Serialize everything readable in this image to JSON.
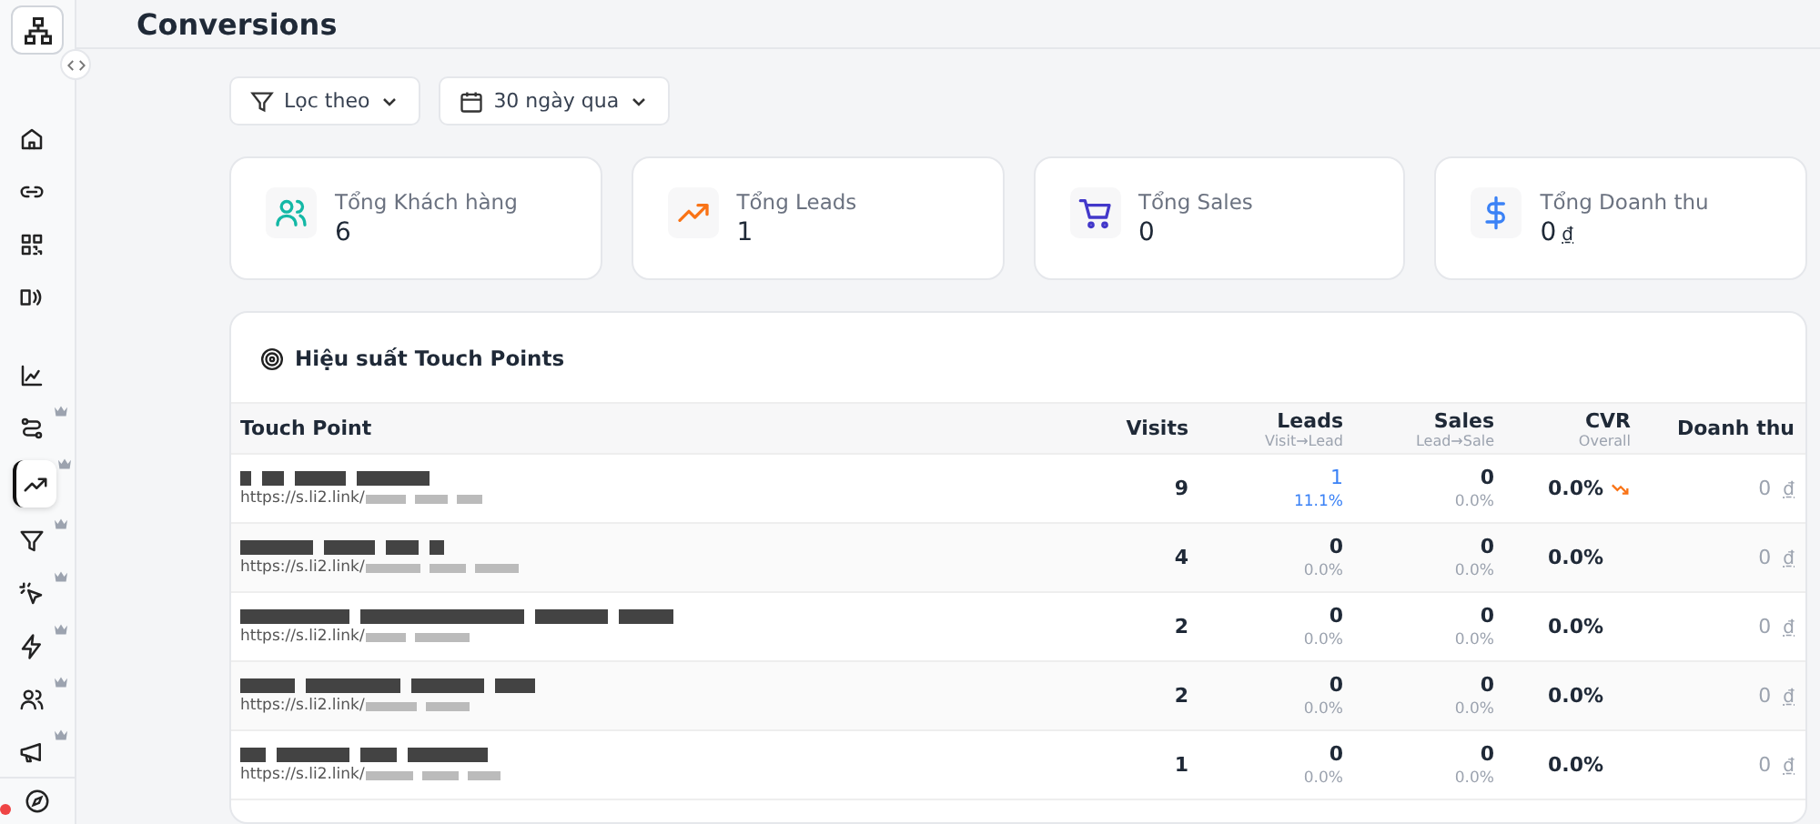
{
  "page_title": "Conversions",
  "sidebar": {
    "items": [
      {
        "kind": "home",
        "premium": false,
        "selected": false
      },
      {
        "kind": "link",
        "premium": false,
        "selected": false
      },
      {
        "kind": "qr",
        "premium": false,
        "selected": false
      },
      {
        "kind": "nfc",
        "premium": false,
        "selected": false
      },
      {
        "kind": "chart",
        "premium": false,
        "selected": false
      },
      {
        "kind": "route",
        "premium": true,
        "selected": false
      },
      {
        "kind": "trend",
        "premium": true,
        "selected": true
      },
      {
        "kind": "funnel",
        "premium": true,
        "selected": false
      },
      {
        "kind": "click",
        "premium": true,
        "selected": false
      },
      {
        "kind": "bolt",
        "premium": true,
        "selected": false
      },
      {
        "kind": "users",
        "premium": true,
        "selected": false
      },
      {
        "kind": "megaphone",
        "premium": true,
        "selected": false
      }
    ],
    "notification": true
  },
  "filters": [
    {
      "kind": "filter",
      "label": "Lọc theo"
    },
    {
      "kind": "date",
      "label": "30 ngày qua"
    }
  ],
  "stats": [
    {
      "kind": "users",
      "label": "Tổng Khách hàng",
      "value": "6",
      "color": "#14b8a6"
    },
    {
      "kind": "trend",
      "label": "Tổng Leads",
      "value": "1",
      "color": "#f97316"
    },
    {
      "kind": "cart",
      "label": "Tổng Sales",
      "value": "0",
      "color": "#4338ca"
    },
    {
      "kind": "dollar",
      "label": "Tổng Doanh thu",
      "value": "0",
      "currency": "₫",
      "color": "#3b82f6"
    }
  ],
  "table": {
    "title": "Hiệu suất Touch Points",
    "columns": [
      {
        "label": "Touch Point"
      },
      {
        "label": "Visits"
      },
      {
        "label": "Leads",
        "sub": "Visit→Lead"
      },
      {
        "label": "Sales",
        "sub": "Lead→Sale"
      },
      {
        "label": "CVR",
        "sub": "Overall"
      },
      {
        "label": "Doanh thu"
      }
    ],
    "rows": [
      {
        "url": "https://s.li2.link/",
        "visits": "9",
        "leads": "1",
        "lead_rate": "11.1%",
        "leads_highlight": true,
        "sales": "0",
        "sale_rate": "0.0%",
        "cvr": "0.0%",
        "trend_down": true,
        "revenue": "0",
        "currency": "₫"
      },
      {
        "url": "https://s.li2.link/",
        "visits": "4",
        "leads": "0",
        "lead_rate": "0.0%",
        "leads_highlight": false,
        "sales": "0",
        "sale_rate": "0.0%",
        "cvr": "0.0%",
        "trend_down": false,
        "revenue": "0",
        "currency": "₫"
      },
      {
        "url": "https://s.li2.link/",
        "visits": "2",
        "leads": "0",
        "lead_rate": "0.0%",
        "leads_highlight": false,
        "sales": "0",
        "sale_rate": "0.0%",
        "cvr": "0.0%",
        "trend_down": false,
        "revenue": "0",
        "currency": "₫"
      },
      {
        "url": "https://s.li2.link/",
        "visits": "2",
        "leads": "0",
        "lead_rate": "0.0%",
        "leads_highlight": false,
        "sales": "0",
        "sale_rate": "0.0%",
        "cvr": "0.0%",
        "trend_down": false,
        "revenue": "0",
        "currency": "₫"
      },
      {
        "url": "https://s.li2.link/",
        "visits": "1",
        "leads": "0",
        "lead_rate": "0.0%",
        "leads_highlight": false,
        "sales": "0",
        "sale_rate": "0.0%",
        "cvr": "0.0%",
        "trend_down": false,
        "revenue": "0",
        "currency": "₫"
      }
    ]
  }
}
